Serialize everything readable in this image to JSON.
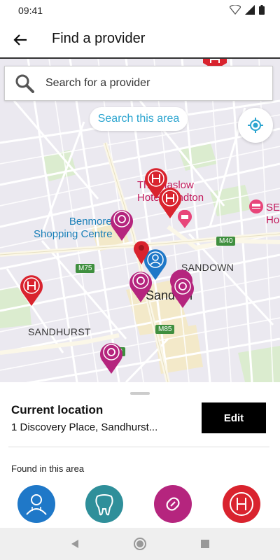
{
  "status": {
    "time": "09:41"
  },
  "header": {
    "title": "Find a provider"
  },
  "search": {
    "placeholder": "Search for a provider",
    "area_button": "Search this area"
  },
  "map": {
    "labels": {
      "hotel_line1": "The Maslow",
      "hotel_line2": "Hotel Sandton",
      "mall_line1": "Benmore",
      "mall_line2": "Shopping Centre",
      "sandown": "SANDOWN",
      "sandton": "Sandton",
      "sandhurst": "SANDHURST",
      "sey_line1": "SEY",
      "sey_line2": "Ho"
    },
    "roads": {
      "m40": "M40",
      "m75": "M75",
      "m85": "M85",
      "m9": "M9"
    },
    "marker_types": [
      "hospital",
      "pharmacy",
      "doctor"
    ],
    "colors": {
      "hospital": "#d9232e",
      "pharmacy": "#b5257e",
      "doctor": "#1f78c8",
      "dentist": "#2f8f9a",
      "location": "#d9232e"
    }
  },
  "current_location": {
    "title": "Current location",
    "address": "1 Discovery Place, Sandhurst...",
    "edit_label": "Edit"
  },
  "found": {
    "label": "Found in this area",
    "categories": [
      "doctor",
      "dentist",
      "pharmacy",
      "hospital"
    ]
  }
}
